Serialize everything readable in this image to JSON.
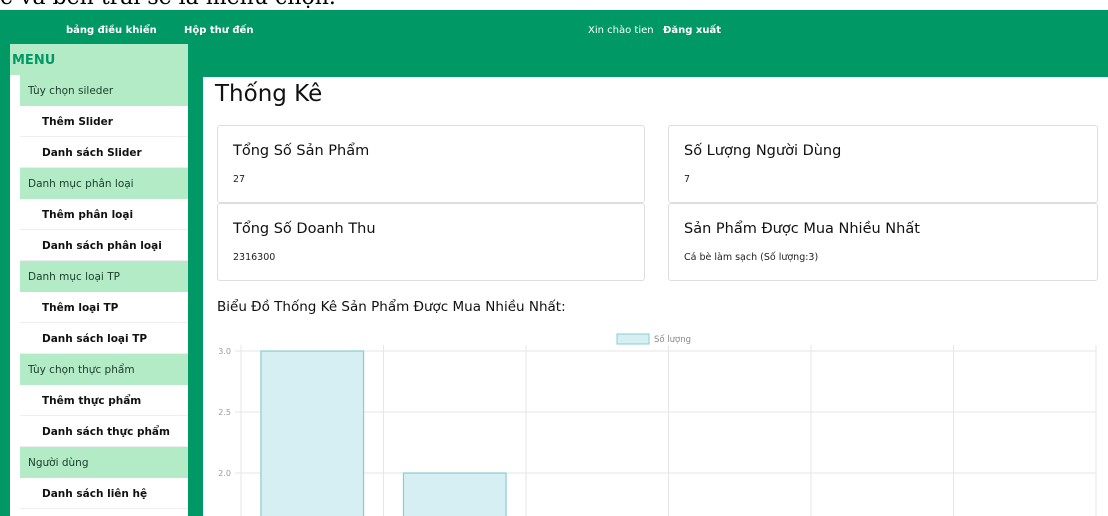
{
  "caption": "ê và bên trái sẽ là menu chọn.",
  "topbar": {
    "brand": "bảng điều khiển",
    "inbox": "Hộp thư đến",
    "greeting": "Xin chào tien",
    "logout": "Đăng xuất"
  },
  "sidebar": {
    "title": "MENU",
    "groups": [
      {
        "label": "Tùy chọn sileder",
        "items": [
          "Thêm Slider",
          "Danh sách Slider"
        ]
      },
      {
        "label": "Danh mục phân loại",
        "items": [
          "Thêm phân loại",
          "Danh sách phân loại"
        ]
      },
      {
        "label": "Danh mục loại TP",
        "items": [
          "Thêm loại TP",
          "Danh sách loại TP"
        ]
      },
      {
        "label": "Tùy chọn thực phẩm",
        "items": [
          "Thêm thực phẩm",
          "Danh sách thực phẩm"
        ]
      },
      {
        "label": "Người dùng",
        "items": [
          "Danh sách liên hệ"
        ]
      }
    ]
  },
  "main": {
    "title": "Thống Kê",
    "cards": [
      {
        "title": "Tổng Số Sản Phẩm",
        "value": "27"
      },
      {
        "title": "Số Lượng Người Dùng",
        "value": "7"
      },
      {
        "title": "Tổng Số Doanh Thu",
        "value": "2316300"
      },
      {
        "title": "Sản Phẩm Được Mua Nhiều Nhất",
        "value": "Cá bè làm sạch (Số lượng:3)"
      }
    ],
    "chart_heading": "Biểu Đồ Thống Kê Sản Phẩm Được Mua Nhiều Nhất:"
  },
  "chart_data": {
    "type": "bar",
    "series": [
      {
        "name": "Số lượng",
        "values": [
          3,
          2
        ]
      }
    ],
    "yticks": [
      3.0,
      2.5,
      2.0
    ],
    "ylim": [
      1.5,
      3.0
    ],
    "grid": true,
    "legend": "top",
    "color": "#d6eff2",
    "border_color": "#88cdd4"
  },
  "colors": {
    "brand": "#009966",
    "menu_group_bg": "#b3ebc7"
  }
}
